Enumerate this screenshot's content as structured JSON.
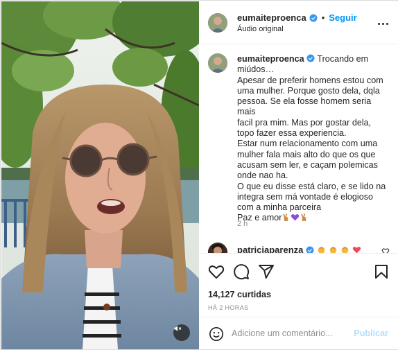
{
  "post": {
    "username": "eumaiteproenca",
    "follow_label": "Seguir",
    "audio_label": "Áudio original",
    "caption_lines": [
      "Trocando em",
      "miúdos…",
      "Apesar de preferir homens estou com",
      "uma mulher. Porque gosto dela, dqla",
      "pessoa. Se ela fosse homem seria mais",
      "facil pra mim. Mas por gostar dela,",
      "topo fazer essa experiencia.",
      "Estar num relacionamento com uma",
      "mulher fala mais alto do que os que",
      "acusam sem ler, e caçam polemicas",
      "onde nao ha.",
      "O que eu disse está claro, e se lido na",
      "integra sem má vontade é elogioso",
      "com a minha parceira",
      "Paz e amor"
    ],
    "caption_time": "2 h",
    "likes": "14,127 curtidas",
    "time_ago": "HÁ 2 HORAS"
  },
  "comment": {
    "username": "patriciaparenza"
  },
  "comment_box": {
    "placeholder": "Adicione um comentário...",
    "publish_label": "Publicar"
  },
  "colors": {
    "accent": "#0095f6",
    "verified": "#3897f0",
    "heart": "#ed4956",
    "purple_heart": "#8a4fd8"
  },
  "icons": [
    "verified-icon",
    "more-options-icon",
    "heart-icon",
    "comment-icon",
    "share-icon",
    "save-icon",
    "emoji-icon",
    "mute-icon",
    "clap-icon",
    "purple-heart-icon",
    "victory-hand-icon"
  ]
}
